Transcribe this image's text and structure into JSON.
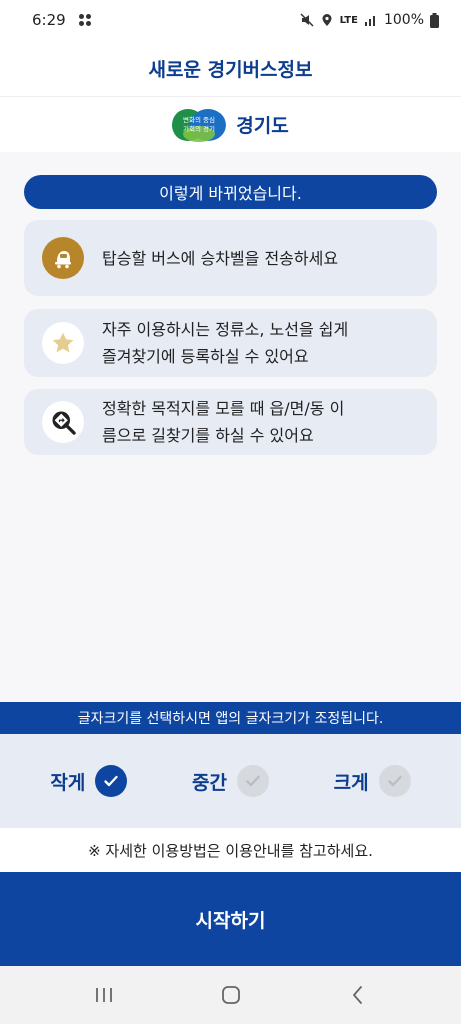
{
  "status_bar": {
    "time": "6:29",
    "network": "LTE",
    "battery": "100%"
  },
  "header": {
    "title": "새로운 경기버스정보"
  },
  "logo": {
    "text": "경기도",
    "mark_line1": "변화의 중심",
    "mark_line2": "기회의 경기",
    "colors": [
      "#1f8f4a",
      "#1d6fc4",
      "#7cc242"
    ]
  },
  "banner": {
    "text": "이렇게 바뀌었습니다."
  },
  "features": [
    {
      "icon": "bell-bus-icon",
      "text": "탑승할 버스에 승차벨을 전송하세요"
    },
    {
      "icon": "star-icon",
      "text": "자주 이용하시는 정류소, 노선을 쉽게\n즐겨찾기에 등록하실 수 있어요"
    },
    {
      "icon": "directions-search-icon",
      "text": "정확한 목적지를 모를 때 읍/면/동 이\n름으로 길찾기를 하실 수 있어요"
    }
  ],
  "font_size": {
    "notice": "글자크기를 선택하시면 앱의 글자크기가 조정됩니다.",
    "options": [
      {
        "label": "작게",
        "selected": true
      },
      {
        "label": "중간",
        "selected": false
      },
      {
        "label": "크게",
        "selected": false
      }
    ]
  },
  "guide": {
    "text": "※ 자세한 이용방법은 이용안내를 참고하세요."
  },
  "start_button": {
    "label": "시작하기"
  },
  "colors": {
    "primary": "#0d45a0",
    "card_bg": "#e6ebf4",
    "accent_gold": "#b8862a"
  }
}
